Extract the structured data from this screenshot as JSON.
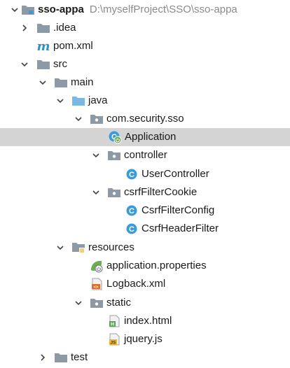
{
  "project": {
    "name": "sso-appa",
    "path": "D:\\myselfProject\\SSO\\sso-appa"
  },
  "items": {
    "idea": ".idea",
    "pom": "pom.xml",
    "src": "src",
    "main": "main",
    "java": "java",
    "package": "com.security.sso",
    "application": "Application",
    "controller": "controller",
    "user_controller": "UserController",
    "csrf_filter_cookie": "csrfFilterCookie",
    "csrf_filter_config": "CsrfFilterConfig",
    "csrf_header_filter": "CsrfHeaderFilter",
    "resources": "resources",
    "application_properties": "application.properties",
    "logback": "Logback.xml",
    "static": "static",
    "index_html": "index.html",
    "jquery_js": "jquery.js",
    "test": "test"
  },
  "icons": {
    "pom_letter": "m",
    "class_letter": "C",
    "html_letter": "H",
    "js_letter": "JS",
    "xml_letter": "<>"
  },
  "colors": {
    "folder": "#8d9aa6",
    "source_folder": "#7ab7e2",
    "class_icon": "#3a9bd9",
    "selection": "#d4d4d4",
    "spring_leaf": "#6bad4f"
  }
}
